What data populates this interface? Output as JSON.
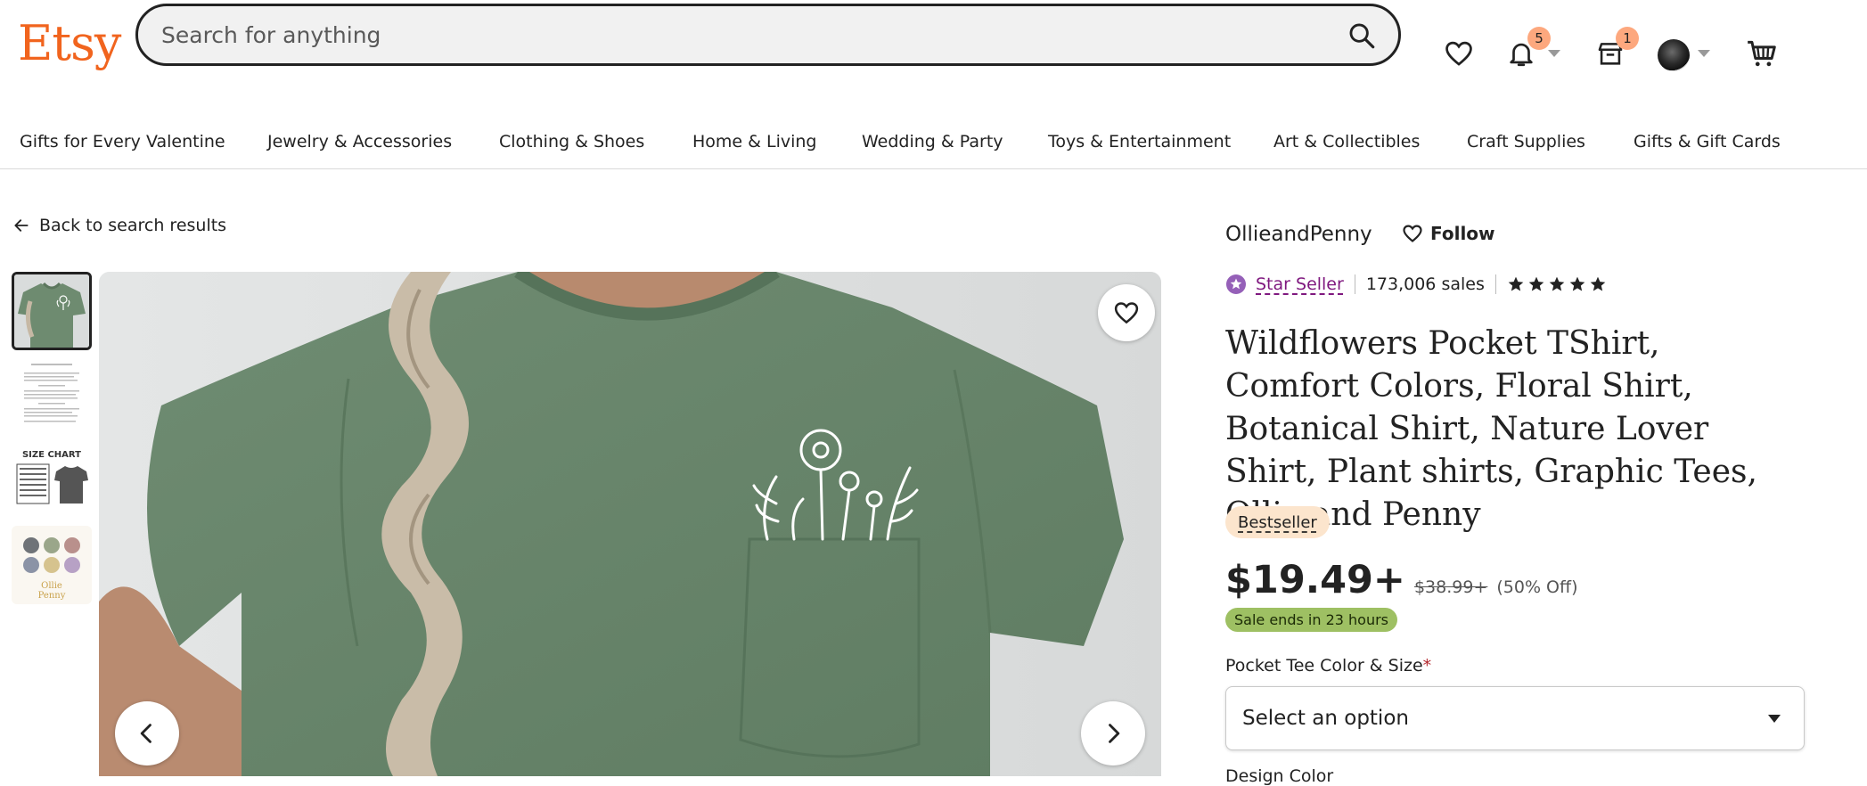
{
  "header": {
    "logo": "Etsy",
    "search_placeholder": "Search for anything",
    "notifications_count": "5",
    "cart_shop_count": "1"
  },
  "categories": [
    "Gifts for Every Valentine",
    "Jewelry & Accessories",
    "Clothing & Shoes",
    "Home & Living",
    "Wedding & Party",
    "Toys & Entertainment",
    "Art & Collectibles",
    "Craft Supplies",
    "Gifts & Gift Cards"
  ],
  "gallery": {
    "back_label": "Back to search results",
    "thumb_text": {
      "size_chart": "SIZE CHART",
      "ollie": "Ollie",
      "penny": "Penny"
    }
  },
  "product": {
    "shop_name": "OllieandPenny",
    "follow_label": "Follow",
    "star_seller_label": "Star Seller",
    "sales": "173,006 sales",
    "rating_stars": 5,
    "title": "Wildflowers Pocket TShirt, Comfort Colors, Floral Shirt, Botanical Shirt, Nature Lover Shirt, Plant shirts, Graphic Tees, Ollie and Penny",
    "badge": "Bestseller",
    "price": "$19.49+",
    "original_price": "$38.99+",
    "discount": "(50% Off)",
    "sale_text": "Sale ends in 23 hours",
    "option1_label": "Pocket Tee Color & Size",
    "option1_required": "*",
    "option1_value": "Select an option",
    "option2_label": "Design Color"
  },
  "colors": {
    "brand": "#F1641E",
    "star_seller": "#7F187F",
    "bestseller_bg": "#FCE5CD",
    "sale_bg": "#9EC063",
    "shirt": "#6E8B70"
  }
}
